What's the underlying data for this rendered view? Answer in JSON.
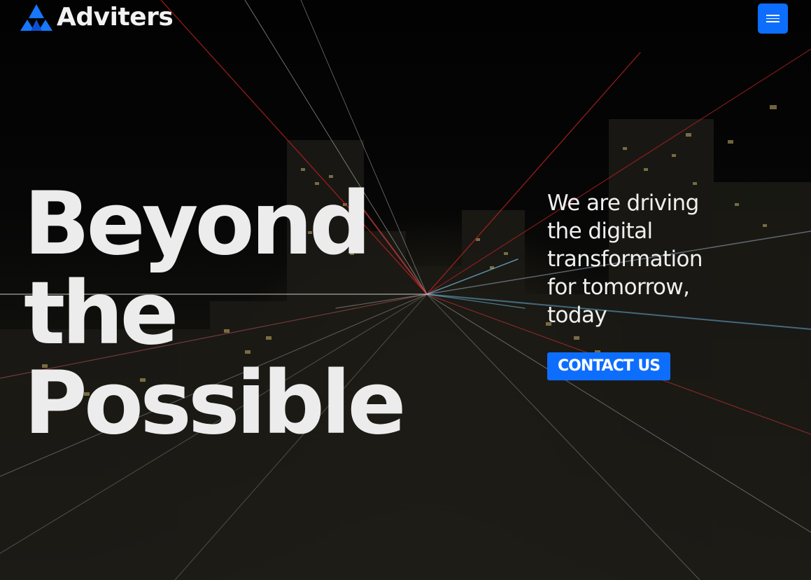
{
  "brand": {
    "name": "Adviters",
    "logo_icon": "adviters-logo-icon",
    "accent_color": "#0d6efd"
  },
  "header": {
    "menu_icon": "hamburger-menu-icon"
  },
  "hero": {
    "headline_lines": [
      "Beyond",
      "the",
      "Possible"
    ],
    "tagline": "We are driving the digital transformation for tomorrow, today",
    "cta_label": "CONTACT US",
    "background": "night-city-light-trails-photo"
  }
}
